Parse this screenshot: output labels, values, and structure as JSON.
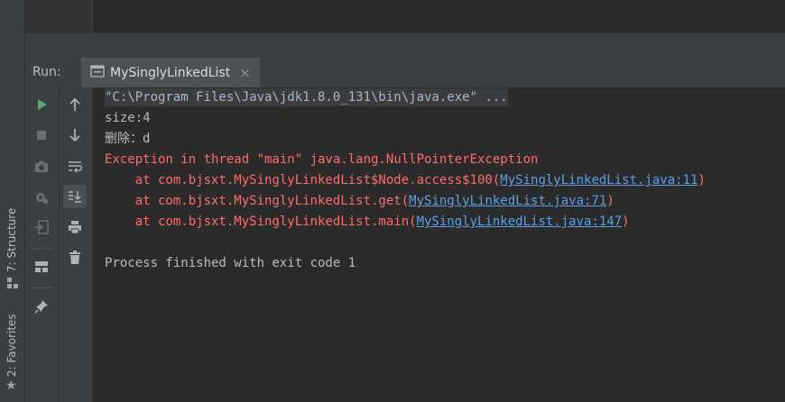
{
  "side_tabs": {
    "structure": "7: Structure",
    "favorites": "2: Favorites"
  },
  "run_panel": {
    "label": "Run:",
    "tab_title": "MySinglyLinkedList",
    "close_glyph": "×"
  },
  "toolbar": {
    "col1": [
      "run-icon",
      "stop-icon",
      "camera-icon",
      "debug-settings-icon",
      "exit-icon",
      "layout-icon",
      "pin-icon"
    ],
    "col2": [
      "up-arrow-icon",
      "down-arrow-icon",
      "soft-wrap-icon",
      "scroll-to-end-icon",
      "print-icon",
      "trash-icon"
    ]
  },
  "console": {
    "command": "\"C:\\Program Files\\Java\\jdk1.8.0_131\\bin\\java.exe\" ...",
    "size_line": "size:4",
    "delete_line": "删除：d",
    "exception": "Exception in thread \"main\" java.lang.NullPointerException",
    "frames": [
      {
        "prefix": "    at com.bjsxt.MySinglyLinkedList$Node.access$100(",
        "link": "MySinglyLinkedList.java:11",
        "suffix": ")"
      },
      {
        "prefix": "    at com.bjsxt.MySinglyLinkedList.get(",
        "link": "MySinglyLinkedList.java:71",
        "suffix": ")"
      },
      {
        "prefix": "    at com.bjsxt.MySinglyLinkedList.main(",
        "link": "MySinglyLinkedList.java:147",
        "suffix": ")"
      }
    ],
    "finish": "Process finished with exit code 1"
  },
  "colors": {
    "error": "#ff6b68",
    "link": "#5a9fe8",
    "run_green": "#59a869",
    "panel_bg": "#3c3f41",
    "console_bg": "#2b2b2b"
  }
}
